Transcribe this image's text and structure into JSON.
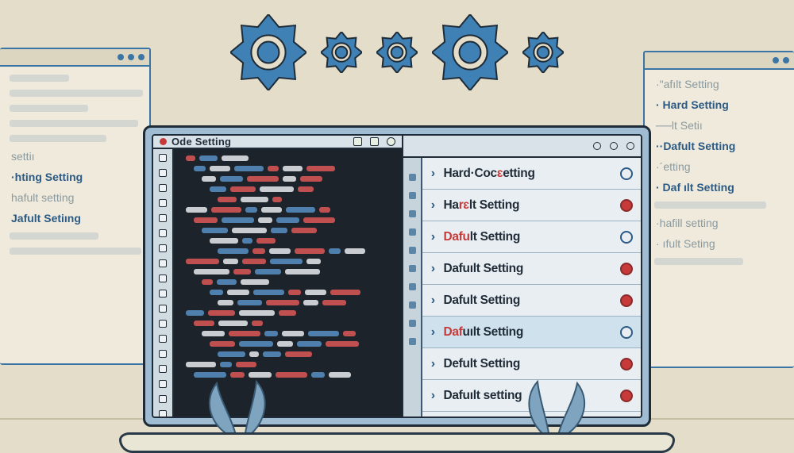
{
  "colors": {
    "bg": "#e3ddc9",
    "gear": "#3f80b5",
    "gear_stroke": "#1f2c38",
    "accent_red": "#c73a3a",
    "accent_blue": "#2b5a84"
  },
  "gears": [
    {
      "size": "large"
    },
    {
      "size": "small"
    },
    {
      "size": "small"
    },
    {
      "size": "large"
    },
    {
      "size": "small"
    }
  ],
  "bg_left": {
    "header_dots": 3,
    "lines": [
      {
        "kind": "scribble"
      },
      {
        "kind": "scribble"
      },
      {
        "kind": "scribble"
      },
      {
        "kind": "scribble"
      },
      {
        "kind": "scribble"
      },
      {
        "kind": "label",
        "text": "settiı",
        "quiet": true
      },
      {
        "kind": "label",
        "text": "·hting Setting",
        "quiet": false
      },
      {
        "kind": "label",
        "text": "hafult setting",
        "quiet": true
      },
      {
        "kind": "label",
        "text": "Jafult Setiıng",
        "quiet": false
      },
      {
        "kind": "scribble"
      },
      {
        "kind": "scribble"
      }
    ]
  },
  "bg_right": {
    "header_dots": 2,
    "lines": [
      {
        "kind": "label",
        "text": "·\"afılt Setting",
        "quiet": true
      },
      {
        "kind": "label",
        "text": "· Hard  Setting",
        "quiet": false
      },
      {
        "kind": "label",
        "text": "──lt Setiı",
        "quiet": true
      },
      {
        "kind": "label",
        "text": "··Dafult Setting",
        "quiet": false
      },
      {
        "kind": "label",
        "text": "·´etting",
        "quiet": true
      },
      {
        "kind": "label",
        "text": "· Daf ılt Setting",
        "quiet": false
      },
      {
        "kind": "scribble"
      },
      {
        "kind": "label",
        "text": "·hafill setting",
        "quiet": true
      },
      {
        "kind": "label",
        "text": "· ıfult Seting",
        "quiet": true
      },
      {
        "kind": "scribble"
      }
    ]
  },
  "editor": {
    "title": "Ode Setting",
    "code_rows": 22,
    "gutter_count": 18
  },
  "settings": {
    "title": "",
    "gutter_count": 10,
    "items": [
      {
        "label_plain": "Hard·Coc",
        "label_accent": "ɛ",
        "label_tail": "etting",
        "status": "blue",
        "highlight": false
      },
      {
        "label_plain": "Ha",
        "label_accent": "rɛ",
        "label_tail": "lt Setting",
        "status": "red",
        "highlight": false
      },
      {
        "label_plain": "",
        "label_accent": "Dafu",
        "label_tail": "lt Setting",
        "status": "blue",
        "highlight": false
      },
      {
        "label_plain": "Dafuılt Setting",
        "label_accent": "",
        "label_tail": "",
        "status": "red",
        "highlight": false
      },
      {
        "label_plain": "Dafult Setting",
        "label_accent": "",
        "label_tail": "",
        "status": "red",
        "highlight": false
      },
      {
        "label_plain": "",
        "label_accent": "Daf",
        "label_tail": "uılt Setting",
        "status": "blue",
        "highlight": true
      },
      {
        "label_plain": "Defult Setting",
        "label_accent": "",
        "label_tail": "",
        "status": "red",
        "highlight": false
      },
      {
        "label_plain": "Dafuılt setting",
        "label_accent": "",
        "label_tail": "",
        "status": "red",
        "highlight": false
      }
    ]
  }
}
